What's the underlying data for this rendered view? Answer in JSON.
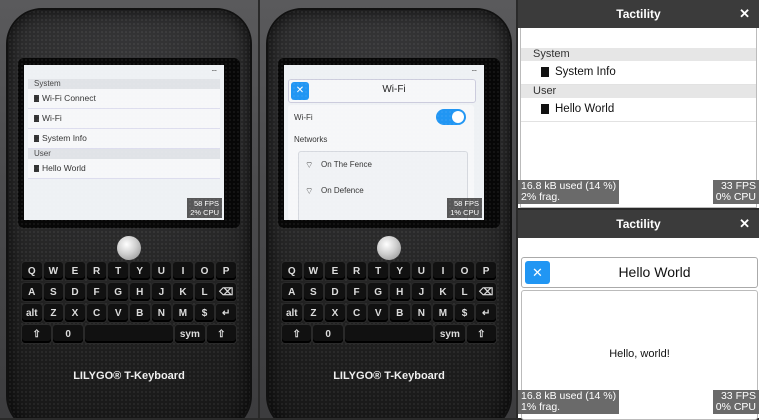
{
  "photo1": {
    "sections": [
      {
        "label": "System",
        "items": [
          "Wi-Fi Connect",
          "Wi-Fi",
          "System Info"
        ]
      },
      {
        "label": "User",
        "items": [
          "Hello World"
        ]
      }
    ],
    "fps": "58 FPS",
    "cpu": "2% CPU"
  },
  "photo2": {
    "title": "Wi-Fi",
    "close_icon": "✕",
    "wifi_label": "Wi-Fi",
    "networks_label": "Networks",
    "networks": [
      "On The Fence",
      "On Defence"
    ],
    "fps": "58 FPS",
    "cpu": "1% CPU"
  },
  "keyboard": {
    "rows": [
      [
        "Q",
        "W",
        "E",
        "R",
        "T",
        "Y",
        "U",
        "I",
        "O",
        "P"
      ],
      [
        "A",
        "S",
        "D",
        "F",
        "G",
        "H",
        "J",
        "K",
        "L",
        "⌫"
      ],
      [
        "alt",
        "Z",
        "X",
        "C",
        "V",
        "B",
        "N",
        "M",
        "$",
        "↵"
      ],
      [
        "⇧",
        "0",
        "",
        "",
        "sym",
        "⇧"
      ]
    ],
    "brand": "LILYGO® T-Keyboard"
  },
  "win1": {
    "title": "Tactility",
    "close": "✕",
    "sections": [
      {
        "label": "System",
        "items": [
          "System Info"
        ]
      },
      {
        "label": "User",
        "items": [
          "Hello World"
        ]
      }
    ],
    "mem_line1": "16.8 kB used (14 %)",
    "mem_line2": "2% frag.",
    "fps": "33 FPS",
    "cpu": "0% CPU"
  },
  "win2": {
    "title": "Tactility",
    "close": "✕",
    "app_title": "Hello World",
    "app_close": "✕",
    "message": "Hello, world!",
    "mem_line1": "16.8 kB used (14 %)",
    "mem_line2": "1% frag.",
    "fps": "33 FPS",
    "cpu": "0% CPU"
  },
  "colors": {
    "accent": "#2196f3",
    "titlebar": "#3b3b3b",
    "section": "#e6e6e6"
  }
}
